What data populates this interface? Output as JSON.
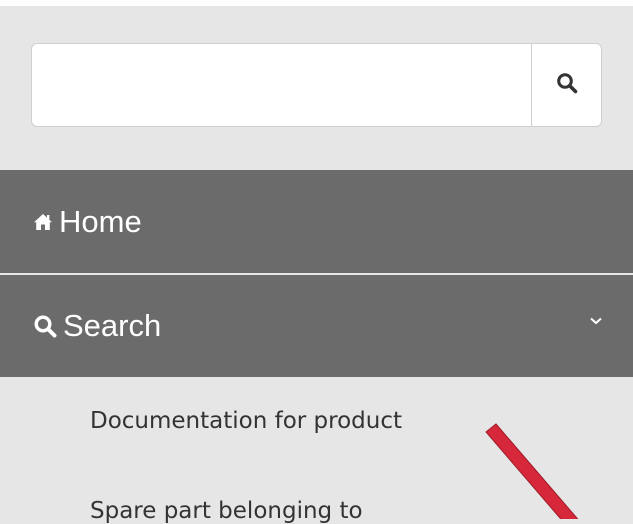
{
  "search": {
    "value": "",
    "placeholder": "",
    "button_icon": "search-icon"
  },
  "nav": {
    "home": {
      "label": "Home",
      "icon": "home-icon"
    },
    "search": {
      "label": "Search",
      "icon": "search-icon",
      "expanded": true,
      "toggle_icon": "chevron-down-icon"
    }
  },
  "submenu": {
    "items": [
      {
        "label": "Documentation for product"
      },
      {
        "label": "Spare part belonging to"
      }
    ]
  },
  "colors": {
    "background": "#e6e6e6",
    "nav_background": "#6b6b6b",
    "nav_text": "#ffffff",
    "annotation_arrow": "#d6283a"
  }
}
